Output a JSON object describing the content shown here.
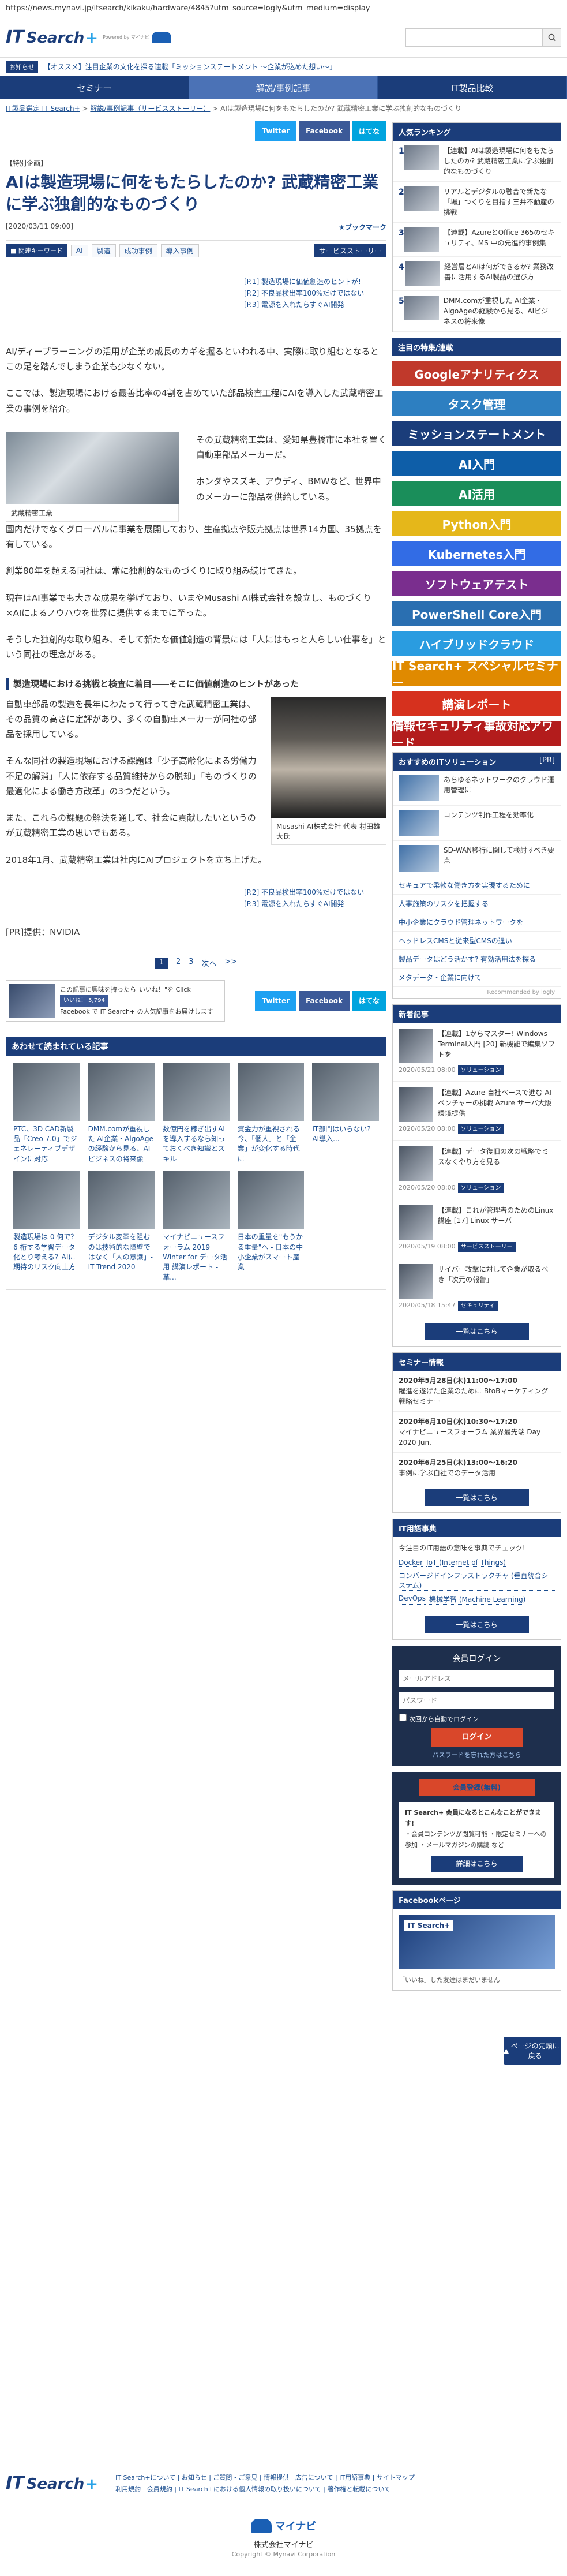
{
  "url": "https://news.mynavi.jp/itsearch/kikaku/hardware/4845?utm_source=logly&utm_medium=display",
  "header": {
    "logo_it": "IT",
    "logo_search": "Search",
    "logo_plus": "+",
    "powered_by": "Powered by マイナビ",
    "search_placeholder": ""
  },
  "notice": {
    "tag": "お知らせ",
    "text": "【オススメ】注目企業の文化を探る連載「ミッションステートメント ～企業が込めた想い～」"
  },
  "nav": {
    "items": [
      {
        "label": "セミナー"
      },
      {
        "label": "解説/事例記事"
      },
      {
        "label": "IT製品比較"
      }
    ]
  },
  "breadcrumb": {
    "home": "IT製品選定 IT Search+",
    "sep1": ">",
    "category": "解説/事例記事（サービスストーリー）",
    "sep2": ">",
    "current": "AIは製造現場に何をもたらしたのか? 武蔵精密工業に学ぶ独創的なものづくり"
  },
  "share": {
    "twitter": "Twitter",
    "facebook": "Facebook",
    "hatena": "はてな"
  },
  "article": {
    "label": "【特別企画】",
    "title": "AIは製造現場に何をもたらしたのか? 武蔵精密工業に学ぶ独創的なものづくり",
    "date": "[2020/03/11 09:00]",
    "bookmark": "ブックマーク",
    "tags_label": "■ 関連キーワード",
    "tags": [
      "AI",
      "製造",
      "成功事例",
      "導入事例"
    ],
    "tag_dark": "サービスストーリー",
    "toc": [
      "[P.1] 製造現場に価値創造のヒントが!",
      "[P.2] 不良品検出率100%だけではない",
      "[P.3] 電源を入れたらすぐAI開発"
    ],
    "lead": "AI/ディープラーニングの活用が企業の成長のカギを握るといわれる中、実際に取り組むとなるとこの足を踏んでしまう企業も少なくない。",
    "p1": "ここでは、製造現場における最善比率の4割を占めていた部品検査工程にAIを導入した武蔵精密工業の事例を紹介。",
    "fig1_caption": "武蔵精密工業",
    "p2": "その武蔵精密工業は、愛知県豊橋市に本社を置く自動車部品メーカーだ。",
    "p3": "ホンダやスズキ、アウディ、BMWなど、世界中のメーカーに部品を供給している。",
    "p4": "国内だけでなくグローバルに事業を展開しており、生産拠点や販売拠点は世界14カ国、35拠点を有している。",
    "p5": "創業80年を超える同社は、常に独創的なものづくりに取り組み続けてきた。",
    "p6": "現在はAI事業でも大きな成果を挙げており、いまやMusashi AI株式会社を設立し、ものづくり×AIによるノウハウを世界に提供するまでに至った。",
    "p7": "そうした独創的な取り組み、そして新たな価値創造の背景には「人にはもっと人らしい仕事を」という同社の理念がある。",
    "sec_head": "製造現場における挑戦と検査に着目――そこに価値創造のヒントがあった",
    "s1": "自動車部品の製造を長年にわたって行ってきた武蔵精密工業は、その品質の高さに定評があり、多くの自動車メーカーが同社の部品を採用している。",
    "s2": "そんな同社の製造現場における課題は「少子高齢化による労働力不足の解消」「人に依存する品質維持からの脱却」「ものづくりの最適化による働き方改革」の3つだという。",
    "s3": "また、これらの課題の解決を通して、社会に貢献したいというのが武蔵精密工業の思いでもある。",
    "portrait_caption": "Musashi AI株式会社 代表 村田雄大氏",
    "s4": "2018年1月、武蔵精密工業は社内にAIプロジェクトを立ち上げた。",
    "toc2": [
      "[P.2] 不良品検出率100%だけではない",
      "[P.3] 電源を入れたらすぐAI開発"
    ],
    "pr": "[PR]提供：NVIDIA"
  },
  "pager": {
    "pages": [
      "1",
      "2",
      "3"
    ],
    "next": "次へ",
    "last": ">>"
  },
  "like": {
    "text": "この記事に興味を持ったら\"いいね！\"を Click",
    "fb_like": "いいね！ 5,794",
    "note": "Facebook で IT Search+ の人気記事をお届けします"
  },
  "recommended": {
    "heading": "あわせて読まれている記事",
    "items": [
      {
        "title": "PTC、3D CAD新製品「Creo 7.0」でジェネレーティブデザインに対応"
      },
      {
        "title": "DMM.comが重視した AI企業・AlgoAgeの経験から見る、AIビジネスの将来像"
      },
      {
        "title": "数億円を稼ぎ出すAIを導入するなら知っておくべき知識とスキル"
      },
      {
        "title": "資金力が重視される今、「個人」と「企業」が変化する時代に"
      },
      {
        "title": "IT部門はいらない? AI導入..."
      },
      {
        "title": "製造現場は 0 何で？ 6 桁する学習データ化とり考える？AIに期待のリスク向上方"
      },
      {
        "title": "デジタル変革を阻むのは技術的な障壁ではなく「人の意識」- IT Trend 2020"
      },
      {
        "title": "マイナビニュースフォーラム 2019 Winter for データ活用 講演レポート - 革..."
      },
      {
        "title": "日本の重量を\"もうかる重量\"へ - 日本の中小企業がスマート産業"
      }
    ]
  },
  "sidebar": {
    "ranking_head": "人気ランキング",
    "ranking": [
      {
        "n": "1",
        "title": "【連載】AIは製造現場に何をもたらしたのか? 武蔵精密工業に学ぶ独創的なものづくり"
      },
      {
        "n": "2",
        "title": "リアルとデジタルの融合で新たな「場」つくりを目指す三井不動産の挑戦"
      },
      {
        "n": "3",
        "title": "【連載】AzureとOffice 365のセキュリティ、MS 中の先進的事例集"
      },
      {
        "n": "4",
        "title": "経営層とAIは何ができるか? 業務改善に活用するAI製品の選び方"
      },
      {
        "n": "5",
        "title": "DMM.comが重視した AI企業・AlgoAgeの経験から見る、AIビジネスの将来像"
      }
    ],
    "focus_head": "注目の特集/連載",
    "banners": [
      {
        "label": "Googleアナリティクス",
        "color": "#c0392b"
      },
      {
        "label": "タスク管理",
        "color": "#2d7fc1"
      },
      {
        "label": "ミッションステートメント",
        "color": "#1b3d7a"
      },
      {
        "label": "AI入門",
        "color": "#0e5ea8"
      },
      {
        "label": "AI活用",
        "color": "#1a8e5a"
      },
      {
        "label": "Python入門",
        "color": "#e5b71a"
      },
      {
        "label": "Kubernetes入門",
        "color": "#326ce5"
      },
      {
        "label": "ソフトウェアテスト",
        "color": "#7a2e8e"
      },
      {
        "label": "PowerShell Core入門",
        "color": "#2a6fb1"
      },
      {
        "label": "ハイブリッドクラウド",
        "color": "#2a9ce0"
      },
      {
        "label": "IT Search+ スペシャルセミナー",
        "color": "#e08a00"
      },
      {
        "label": "講演レポート",
        "color": "#d6311e"
      },
      {
        "label": "情報セキュリティ事故対応アワード",
        "color": "#b31c1c"
      }
    ],
    "solutions_head": "おすすめのITソリューション",
    "pr": "[PR]",
    "solutions": [
      {
        "title": "あらゆるネットワークのクラウド運用管理に"
      },
      {
        "title": "コンテンツ制作工程を効率化"
      },
      {
        "title": "SD-WAN移行に関して検討すべき要点"
      }
    ],
    "sol_links": [
      "セキュアで柔軟な働き方を実現するために",
      "人事施策のリスクを把握する",
      "中小企業にクラウド管理ネットワークを",
      "ヘッドレスCMSと従来型CMSの違い",
      "製品データはどう活かす? 有効活用法を探る",
      "メタデータ・企業に向けて"
    ],
    "recommended_by": "Recommended by logly",
    "news_head": "新着記事",
    "news": [
      {
        "title": "【連載】1からマスター! Windows Terminal入門 [20] 新機能で編集ソフトを",
        "date": "2020/05/21 08:00",
        "cat": "ソリューション"
      },
      {
        "title": "【連載】Azure 自社ペースで進む AIベンチャーの挑戦 Azure サーバ大阪環境提供",
        "date": "2020/05/20 08:00",
        "cat": "ソリューション"
      },
      {
        "title": "【連載】データ復旧の次の戦略でミスなくやり方を見る",
        "date": "2020/05/20 08:00",
        "cat": "ソリューション"
      },
      {
        "title": "【連載】これが管理者のためのLinux講座 [17] Linux サーバ",
        "date": "2020/05/19 08:00",
        "cat": "サービスストーリー"
      },
      {
        "title": "サイバー攻撃に対して企業が取るべき「次元の報告」",
        "date": "2020/05/18 15:47",
        "cat": "セキュリティ"
      }
    ],
    "more": "一覧はこちら",
    "seminar_head": "セミナー情報",
    "seminars": [
      {
        "d": "2020年5月28日(木)11:00～17:00",
        "t": "躍進を遂げた企業のために BtoBマーケティング戦略セミナー"
      },
      {
        "d": "2020年6月10日(水)10:30～17:20",
        "t": "マイナビニュースフォーラム 業界最先端 Day 2020 Jun."
      },
      {
        "d": "2020年6月25日(木)13:00～16:20",
        "t": "事例に学ぶ自社でのデータ活用"
      }
    ],
    "dict_head": "IT用語事典",
    "dict_intro": "今注目のIT用語の意味を事典でチェック!",
    "dict_tags": [
      "Docker",
      "IoT (Internet of Things)",
      "コンバージドインフラストラクチャ (垂直統合システム)",
      "DevOps",
      "機械学習 (Machine Learning)"
    ],
    "login_head": "会員ログイン",
    "login_email_placeholder": "メールアドレス",
    "login_password_placeholder": "パスワード",
    "login_remember": "次回から自動でログイン",
    "login_button": "ログイン",
    "login_forgot": "パスワードを忘れた方はこちら",
    "register_button": "会員登録(無料)",
    "member_head": "IT Search+ 会員になるとこんなことができます!",
    "member_benefits": "・会員コンテンツが閲覧可能 ・限定セミナーへの参加 ・メールマガジンの購読 など",
    "member_more": "詳細はこちら",
    "fb_head": "Facebookページ",
    "fb_page": "IT Search+",
    "fb_note": "「いいね」した友達はまだいません",
    "to_top": "ページの先頭に戻る"
  },
  "footer": {
    "logo_it": "IT",
    "logo_search": "Search",
    "logo_plus": "+",
    "links": "IT Search+について | お知らせ | ご質問・ご意見 | 情報提供 | 広告について | IT用語事典 | サイトマップ",
    "links2": "利用規約 | 会員規約 | IT Search+における個人情報の取り扱いについて | 著作権と転載について",
    "company": "株式会社マイナビ",
    "copyright": "Copyright © Mynavi Corporation",
    "mynavi": "マイナビ"
  }
}
